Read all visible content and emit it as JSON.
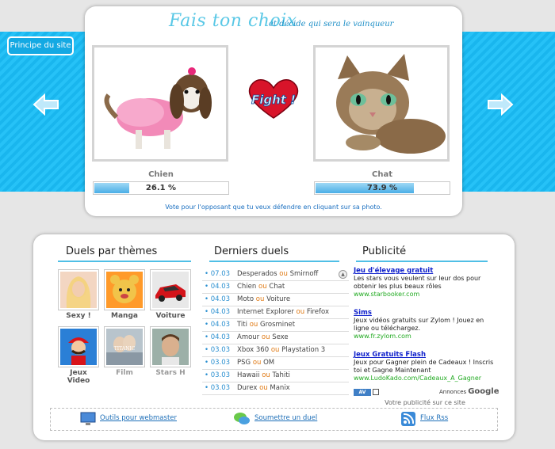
{
  "header": {
    "title": "Fais ton choix",
    "subtitle": "et décide qui sera le vainqueur",
    "principe_label": "Principe du site"
  },
  "fight": {
    "left": {
      "name": "Chien",
      "percent_label": "26.1 %",
      "percent": 26.1
    },
    "right": {
      "name": "Chat",
      "percent_label": "73.9 %",
      "percent": 73.9
    },
    "center_label": "Fight !",
    "vote_note": "Vote pour l'opposant que tu veux défendre en cliquant sur sa photo."
  },
  "sections": {
    "themes_title": "Duels par thèmes",
    "duels_title": "Derniers duels",
    "pub_title": "Publicité"
  },
  "themes": [
    {
      "label": "Sexy !",
      "dim": false
    },
    {
      "label": "Manga",
      "dim": false
    },
    {
      "label": "Voiture",
      "dim": false
    },
    {
      "label": "Jeux Video",
      "dim": false
    },
    {
      "label": "Film",
      "dim": true
    },
    {
      "label": "Stars H",
      "dim": true
    }
  ],
  "duels": {
    "separator": "ou",
    "items": [
      {
        "date": "07.03",
        "a": "Desperados",
        "b": "Smirnoff"
      },
      {
        "date": "04.03",
        "a": "Chien",
        "b": "Chat"
      },
      {
        "date": "04.03",
        "a": "Moto",
        "b": "Voiture"
      },
      {
        "date": "04.03",
        "a": "Internet Explorer",
        "b": "Firefox"
      },
      {
        "date": "04.03",
        "a": "Titi",
        "b": "Grosminet"
      },
      {
        "date": "04.03",
        "a": "Amour",
        "b": "Sexe"
      },
      {
        "date": "03.03",
        "a": "Xbox 360",
        "b": "Playstation 3"
      },
      {
        "date": "03.03",
        "a": "PSG",
        "b": "OM"
      },
      {
        "date": "03.03",
        "a": "Hawaii",
        "b": "Tahiti"
      },
      {
        "date": "03.03",
        "a": "Durex",
        "b": "Manix"
      }
    ]
  },
  "ads": [
    {
      "title": "Jeu d'élevage gratuit",
      "body": "Les stars vous veulent sur leur dos pour obtenir les plus beaux rôles",
      "url": "www.starbooker.com"
    },
    {
      "title": "Sims",
      "body": "Jeux vidéos gratuits sur Zylom ! Jouez en ligne ou téléchargez.",
      "url": "www.fr.zylom.com"
    },
    {
      "title": "Jeux Gratuits Flash",
      "body": "Jeux pour Gagner plein de Cadeaux ! Inscris toi et Gagne Maintenant",
      "url": "www.LudoKado.com/Cadeaux_A_Gagner"
    }
  ],
  "ads_meta": {
    "choices": "AV",
    "annonces": "Annonces",
    "google": "Google",
    "pub_site": "Votre publicité sur ce site"
  },
  "footer": {
    "webmaster": "Outils pour webmaster",
    "submit": "Soumettre un duel",
    "rss": "Flux Rss"
  },
  "colors": {
    "accent": "#4fbfe6",
    "band": "#19b6ee",
    "ou": "#e07a14",
    "date": "#2a8fd0",
    "ad_title": "#1122cc",
    "ad_url": "#22aa22"
  }
}
